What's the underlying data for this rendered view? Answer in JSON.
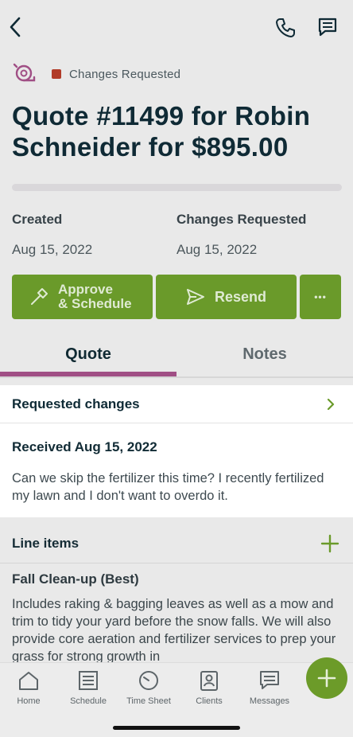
{
  "status": {
    "label": "Changes Requested",
    "color": "#b13b28"
  },
  "quote": {
    "title": "Quote #11499 for Robin Schneider for $895.00"
  },
  "meta": {
    "created_label": "Created",
    "created_value": "Aug 15, 2022",
    "changes_label": "Changes Requested",
    "changes_value": "Aug 15, 2022"
  },
  "actions": {
    "approve_line1": "Approve",
    "approve_line2": "& Schedule",
    "resend": "Resend",
    "more": "•••"
  },
  "tabs": [
    {
      "label": "Quote",
      "active": true
    },
    {
      "label": "Notes",
      "active": false
    }
  ],
  "requested_changes": {
    "header": "Requested changes",
    "received": "Received Aug 15, 2022",
    "message": "Can we skip the fertilizer this time? I recently fertilized my lawn and I don't want to overdo it."
  },
  "line_items": {
    "header": "Line items",
    "items": [
      {
        "title": "Fall Clean-up (Best)",
        "description": "Includes raking & bagging leaves as well as a mow and trim to tidy your yard before the snow falls. We will also provide core aeration and fertilizer services to prep your grass for strong growth in"
      }
    ]
  },
  "nav": [
    {
      "label": "Home",
      "icon": "home-icon"
    },
    {
      "label": "Schedule",
      "icon": "schedule-icon"
    },
    {
      "label": "Time Sheet",
      "icon": "timesheet-icon"
    },
    {
      "label": "Clients",
      "icon": "clients-icon"
    },
    {
      "label": "Messages",
      "icon": "messages-icon"
    }
  ],
  "colors": {
    "accent": "#6a9a2a",
    "tab_indicator": "#a04f85"
  }
}
